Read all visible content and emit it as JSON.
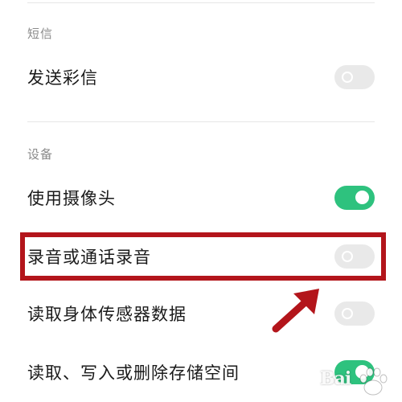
{
  "sections": [
    {
      "title": "短信",
      "items": [
        {
          "label": "发送彩信",
          "enabled": false
        }
      ]
    },
    {
      "title": "设备",
      "items": [
        {
          "label": "使用摄像头",
          "enabled": true
        },
        {
          "label": "录音或通话录音",
          "enabled": false
        },
        {
          "label": "读取身体传感器数据",
          "enabled": false
        },
        {
          "label": "读取、写入或删除存储空间",
          "enabled": true
        }
      ]
    }
  ],
  "annotation": {
    "highlight_color": "#b3151b",
    "highlighted_item": "录音或通话录音"
  },
  "colors": {
    "toggle_on": "#2ec27e",
    "toggle_off": "#e9e9e9"
  },
  "watermark": {
    "text": "Bai"
  }
}
